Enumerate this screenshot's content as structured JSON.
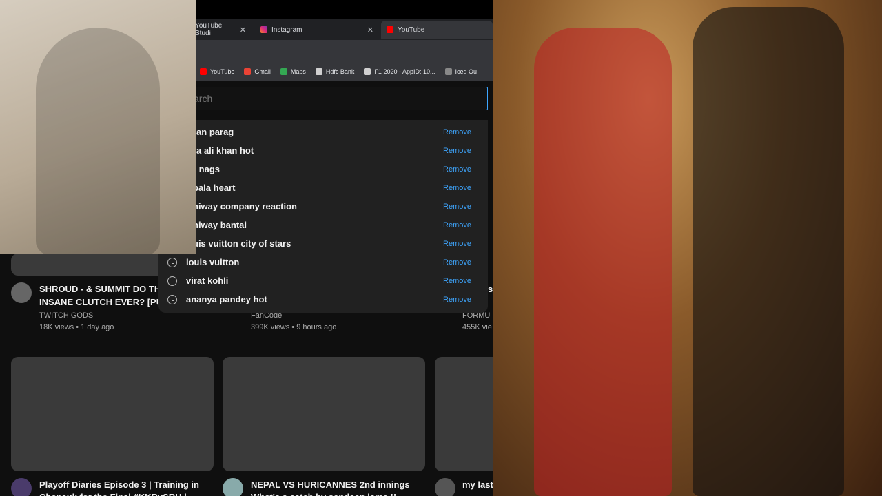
{
  "browser": {
    "tabs": [
      {
        "label": "YouTube Studi",
        "icon": "youtube-studio-icon"
      },
      {
        "label": "Instagram",
        "icon": "instagram-icon"
      },
      {
        "label": "YouTube",
        "icon": "youtube-icon"
      }
    ],
    "bookmarks": [
      {
        "label": "YouTube",
        "icon": "youtube-icon",
        "color": "#ff0000"
      },
      {
        "label": "Gmail",
        "icon": "gmail-icon",
        "color": "#ea4335"
      },
      {
        "label": "Maps",
        "icon": "maps-icon",
        "color": "#34a853"
      },
      {
        "label": "Hdfc Bank",
        "icon": "hdfc-icon",
        "color": "#d0d0d0"
      },
      {
        "label": "F1 2020 - AppID: 10...",
        "icon": "database-icon",
        "color": "#d0d0d0"
      },
      {
        "label": "Iced Ou",
        "icon": "iced-icon",
        "color": "#888888"
      }
    ]
  },
  "search": {
    "placeholder": "arch",
    "remove_label": "Remove",
    "history": [
      "ran parag",
      "ra ali khan hot",
      "r nags",
      "pala heart",
      "niway company reaction",
      "niway bantai",
      "uis vuitton city of stars",
      "louis vuitton",
      "virat kohli",
      "ananya pandey hot"
    ]
  },
  "videos": [
    {
      "title1": "SHROUD - & SUMMIT DO TH",
      "title2": "INSANE CLUTCH EVER? [PU",
      "channel": "TWITCH GODS",
      "meta": "18K views • 1 day ago"
    },
    {
      "title1": "",
      "title2": "",
      "channel": "FanCode",
      "meta": "399K views • 9 hours ago"
    },
    {
      "title1": "s",
      "title2": "s",
      "channel": "FORMU",
      "meta": "455K vie"
    },
    {
      "title1": "Playoff Diaries Episode 3 | Training in",
      "title2": "Chepauk for the Final #KKRvSRH |",
      "channel": "",
      "meta": ""
    },
    {
      "title1": "NEPAL VS HURICANNES 2nd innings",
      "title2": "What's a catch by sandeep lame !!",
      "channel": "",
      "meta": ""
    },
    {
      "title1": "my last",
      "title2": "",
      "channel": "",
      "meta": ""
    }
  ],
  "colors": {
    "accent": "#3ea6ff",
    "background": "#0f0f0f",
    "thumb": "#3a3a3a"
  }
}
